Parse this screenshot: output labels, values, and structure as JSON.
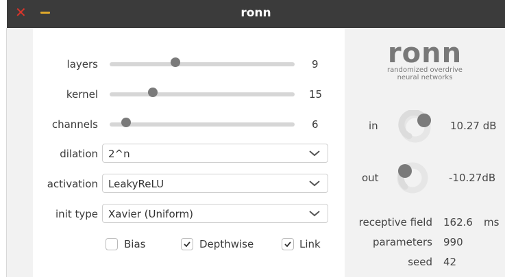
{
  "window": {
    "title": "ronn",
    "close_glyph": "✕"
  },
  "params": {
    "layers": {
      "label": "layers",
      "value": "9",
      "fraction": 0.35
    },
    "kernel": {
      "label": "kernel",
      "value": "15",
      "fraction": 0.23
    },
    "channels": {
      "label": "channels",
      "value": "6",
      "fraction": 0.09
    }
  },
  "dropdowns": {
    "dilation": {
      "label": "dilation",
      "value": "2^n"
    },
    "activation": {
      "label": "activation",
      "value": "LeakyReLU"
    },
    "init_type": {
      "label": "init type",
      "value": "Xavier (Uniform)"
    }
  },
  "checkboxes": {
    "bias": {
      "label": "Bias",
      "checked": false
    },
    "depthwise": {
      "label": "Depthwise",
      "checked": true
    },
    "link": {
      "label": "Link",
      "checked": true
    }
  },
  "brand": {
    "name": "ronn",
    "tagline_1": "randomized overdrive",
    "tagline_2": "neural networks"
  },
  "gain": {
    "in": {
      "label": "in",
      "value": "10.27 dB",
      "level": 0.82
    },
    "out": {
      "label": "out",
      "value": "-10.27dB",
      "level": 0.18
    }
  },
  "info": {
    "receptive_field": {
      "label": "receptive field",
      "value": "162.6",
      "unit": "ms"
    },
    "parameters": {
      "label": "parameters",
      "value": "990"
    },
    "seed": {
      "label": "seed",
      "value": "42"
    }
  },
  "colors": {
    "titlebar": "#3b3b3b",
    "close": "#d9352b",
    "minimize": "#e0a92b",
    "panel": "#f2f2f2",
    "knob": "#7a7a7a"
  }
}
